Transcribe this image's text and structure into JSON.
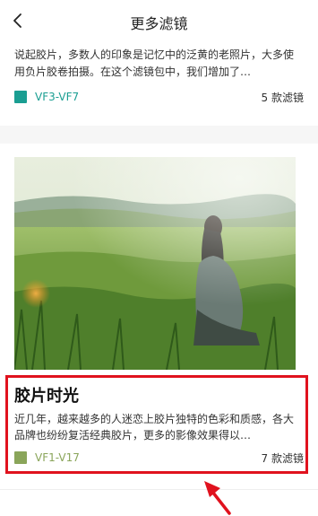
{
  "header": {
    "title": "更多滤镜",
    "back_icon": "chevron-left-icon"
  },
  "filters": [
    {
      "description": "说起胶片，多数人的印象是记忆中的泛黄的老照片，大多使用负片胶卷拍摄。在这个滤镜包中，我们增加了…",
      "code": "VF3-VF7",
      "count": "5 款滤镜",
      "color": "#1a9e92"
    },
    {
      "title": "胶片时光",
      "description": "近几年，越来越多的人迷恋上胶片独特的色彩和质感，各大品牌也纷纷复活经典胶片，更多的影像效果得以…",
      "code": "VF1-V17",
      "count": "7 款滤镜",
      "color": "#8aa55a"
    }
  ],
  "annotation": {
    "box_color": "#e0121e",
    "arrow_color": "#e0121e"
  }
}
